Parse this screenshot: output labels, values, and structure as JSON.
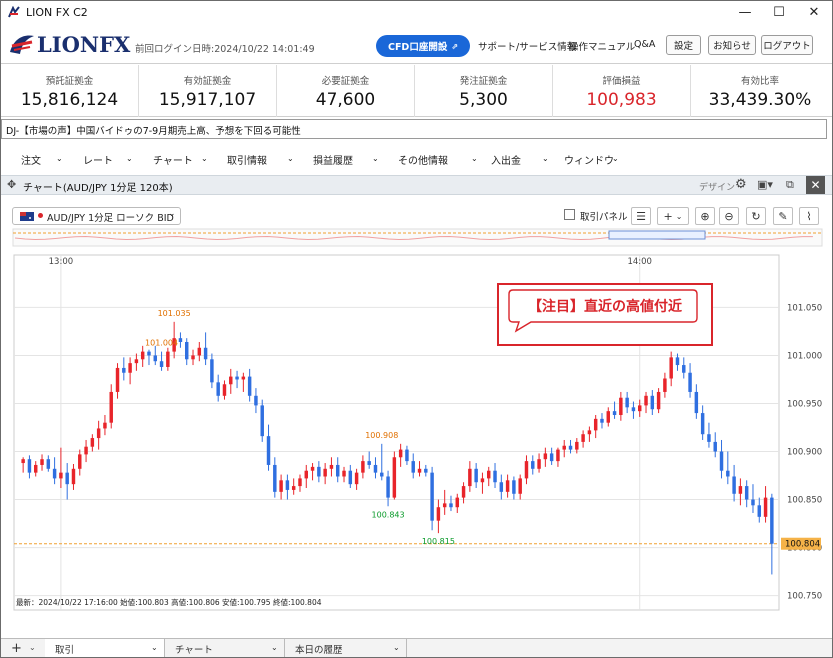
{
  "window": {
    "title": "LION FX C2",
    "controls": {
      "minimize": "—",
      "maximize": "☐",
      "close": "✕"
    }
  },
  "header": {
    "logo": "LIONFX",
    "last_login": "前回ログイン日時:2024/10/22 14:01:49",
    "cfd_button": "CFD口座開設",
    "links": [
      "サポート/サービス情報",
      "操作マニュアル",
      "Q&A"
    ],
    "buttons": [
      "設定",
      "お知らせ",
      "ログアウト"
    ]
  },
  "account": [
    {
      "label": "預託証拠金",
      "value": "15,816,124"
    },
    {
      "label": "有効証拠金",
      "value": "15,917,107"
    },
    {
      "label": "必要証拠金",
      "value": "47,600"
    },
    {
      "label": "発注証拠金",
      "value": "5,300"
    },
    {
      "label": "評価損益",
      "value": "100,983",
      "color": "#d9252b"
    },
    {
      "label": "有効比率",
      "value": "33,439.30%"
    }
  ],
  "news": "DJ-【市場の声】中国バイドゥの7-9月期売上高、予想を下回る可能性",
  "menu": [
    "注文",
    "レート",
    "チャート",
    "取引情報",
    "損益履歴",
    "その他情報",
    "入出金",
    "ウィンドウ"
  ],
  "panel": {
    "title": "チャート(AUD/JPY 1分足 120本)",
    "design_label": "デザイン"
  },
  "toolbar": {
    "symbol": "AUD/JPY 1分足 ローソク BID",
    "trade_panel": "取引パネル",
    "plus": "+",
    "caret": "⌄"
  },
  "chart_data": {
    "type": "candlestick",
    "symbol": "AUD/JPY",
    "x_labels": [
      "13:00",
      "14:00"
    ],
    "y_ticks": [
      101.05,
      101.0,
      100.95,
      100.9,
      100.85,
      100.8,
      100.75
    ],
    "y_tick_labels": [
      "101.050",
      "101.000",
      "100.950",
      "100.900",
      "100.850",
      "100.800",
      "100.750"
    ],
    "ylim": [
      100.735,
      101.09
    ],
    "current_price": "100.804",
    "current_price_value": 100.804,
    "annotations": [
      {
        "text": "101.035",
        "price": 101.035,
        "kind": "high",
        "color": "#e07000"
      },
      {
        "text": "100.908",
        "price": 100.908,
        "kind": "high",
        "color": "#e07000"
      },
      {
        "text": "100.843",
        "price": 100.843,
        "kind": "low",
        "color": "#0a9a2a"
      },
      {
        "text": "100.815",
        "price": 100.815,
        "kind": "low",
        "color": "#0a9a2a"
      },
      {
        "text": "101.004",
        "price": 101.004,
        "kind": "high",
        "color": "#e07000"
      }
    ],
    "callout": "【注目】直近の高値付近",
    "status": "最新：2024/10/22 17:16:00 始値:100.803 高値:100.806 安値:100.795 終値:100.804",
    "up_color": "#e8242a",
    "down_color": "#2f6fe0",
    "candles": [
      [
        100.888,
        100.894,
        100.878,
        100.892
      ],
      [
        100.892,
        100.896,
        100.872,
        100.878
      ],
      [
        100.878,
        100.89,
        100.874,
        100.886
      ],
      [
        100.886,
        100.897,
        100.88,
        100.892
      ],
      [
        100.892,
        100.896,
        100.879,
        100.882
      ],
      [
        100.882,
        100.894,
        100.866,
        100.872
      ],
      [
        100.872,
        100.904,
        100.862,
        100.878
      ],
      [
        100.878,
        100.888,
        100.85,
        100.866
      ],
      [
        100.866,
        100.887,
        100.86,
        100.882
      ],
      [
        100.882,
        100.902,
        100.875,
        100.897
      ],
      [
        100.897,
        100.912,
        100.889,
        100.905
      ],
      [
        100.905,
        100.918,
        100.9,
        100.914
      ],
      [
        100.914,
        100.932,
        100.902,
        100.924
      ],
      [
        100.924,
        100.938,
        100.917,
        100.93
      ],
      [
        100.93,
        100.97,
        100.924,
        100.962
      ],
      [
        100.962,
        100.992,
        100.955,
        100.987
      ],
      [
        100.987,
        100.998,
        100.974,
        100.982
      ],
      [
        100.982,
        100.998,
        100.97,
        100.992
      ],
      [
        100.992,
        101.002,
        100.984,
        100.996
      ],
      [
        100.996,
        101.01,
        100.988,
        101.004
      ],
      [
        101.004,
        101.006,
        100.99,
        101.0
      ],
      [
        101.0,
        101.01,
        100.99,
        100.994
      ],
      [
        100.994,
        101.004,
        100.984,
        100.988
      ],
      [
        100.988,
        101.008,
        100.984,
        101.004
      ],
      [
        101.004,
        101.035,
        100.997,
        101.018
      ],
      [
        101.018,
        101.024,
        101.008,
        101.014
      ],
      [
        101.014,
        101.018,
        100.99,
        100.996
      ],
      [
        100.996,
        101.006,
        100.99,
        101.0
      ],
      [
        101.0,
        101.014,
        100.994,
        101.008
      ],
      [
        101.008,
        101.024,
        100.99,
        100.996
      ],
      [
        100.996,
        101.002,
        100.966,
        100.972
      ],
      [
        100.972,
        100.98,
        100.952,
        100.958
      ],
      [
        100.958,
        100.974,
        100.954,
        100.97
      ],
      [
        100.97,
        100.986,
        100.96,
        100.978
      ],
      [
        100.978,
        100.984,
        100.966,
        100.975
      ],
      [
        100.975,
        100.982,
        100.962,
        100.978
      ],
      [
        100.978,
        100.986,
        100.952,
        100.958
      ],
      [
        100.958,
        100.966,
        100.94,
        100.948
      ],
      [
        100.948,
        100.954,
        100.91,
        100.916
      ],
      [
        100.916,
        100.928,
        100.88,
        100.886
      ],
      [
        100.886,
        100.894,
        100.852,
        100.858
      ],
      [
        100.858,
        100.876,
        100.85,
        100.87
      ],
      [
        100.87,
        100.876,
        100.85,
        100.86
      ],
      [
        100.86,
        100.872,
        100.855,
        100.864
      ],
      [
        100.864,
        100.876,
        100.858,
        100.872
      ],
      [
        100.872,
        100.886,
        100.862,
        100.88
      ],
      [
        100.88,
        100.888,
        100.87,
        100.884
      ],
      [
        100.884,
        100.89,
        100.868,
        100.874
      ],
      [
        100.874,
        100.888,
        100.866,
        100.882
      ],
      [
        100.882,
        100.894,
        100.874,
        100.886
      ],
      [
        100.886,
        100.894,
        100.868,
        100.874
      ],
      [
        100.874,
        100.884,
        100.868,
        100.88
      ],
      [
        100.88,
        100.886,
        100.862,
        100.866
      ],
      [
        100.866,
        100.882,
        100.86,
        100.878
      ],
      [
        100.878,
        100.896,
        100.872,
        100.89
      ],
      [
        100.89,
        100.9,
        100.882,
        100.886
      ],
      [
        100.886,
        100.894,
        100.872,
        100.878
      ],
      [
        100.878,
        100.908,
        100.87,
        100.874
      ],
      [
        100.874,
        100.88,
        100.843,
        100.852
      ],
      [
        100.852,
        100.9,
        100.85,
        100.894
      ],
      [
        100.894,
        100.908,
        100.884,
        100.902
      ],
      [
        100.902,
        100.906,
        100.886,
        100.89
      ],
      [
        100.89,
        100.898,
        100.872,
        100.878
      ],
      [
        100.878,
        100.89,
        100.874,
        100.882
      ],
      [
        100.882,
        100.886,
        100.874,
        100.878
      ],
      [
        100.878,
        100.884,
        100.818,
        100.828
      ],
      [
        100.828,
        100.85,
        100.815,
        100.842
      ],
      [
        100.842,
        100.86,
        100.834,
        100.846
      ],
      [
        100.846,
        100.854,
        100.838,
        100.842
      ],
      [
        100.842,
        100.856,
        100.836,
        100.852
      ],
      [
        100.852,
        100.868,
        100.846,
        100.864
      ],
      [
        100.864,
        100.89,
        100.858,
        100.882
      ],
      [
        100.882,
        100.888,
        100.862,
        100.868
      ],
      [
        100.868,
        100.878,
        100.856,
        100.872
      ],
      [
        100.872,
        100.884,
        100.864,
        100.88
      ],
      [
        100.88,
        100.888,
        100.862,
        100.868
      ],
      [
        100.868,
        100.876,
        100.85,
        100.858
      ],
      [
        100.858,
        100.876,
        100.852,
        100.87
      ],
      [
        100.87,
        100.874,
        100.85,
        100.856
      ],
      [
        100.856,
        100.876,
        100.85,
        100.872
      ],
      [
        100.872,
        100.896,
        100.866,
        100.89
      ],
      [
        100.89,
        100.896,
        100.876,
        100.882
      ],
      [
        100.882,
        100.898,
        100.878,
        100.892
      ],
      [
        100.892,
        100.904,
        100.884,
        100.898
      ],
      [
        100.898,
        100.904,
        100.886,
        100.89
      ],
      [
        100.89,
        100.904,
        100.884,
        100.902
      ],
      [
        100.902,
        100.912,
        100.894,
        100.906
      ],
      [
        100.906,
        100.912,
        100.898,
        100.902
      ],
      [
        100.902,
        100.914,
        100.898,
        100.91
      ],
      [
        100.91,
        100.922,
        100.904,
        100.918
      ],
      [
        100.918,
        100.926,
        100.91,
        100.922
      ],
      [
        100.922,
        100.938,
        100.914,
        100.934
      ],
      [
        100.934,
        100.94,
        100.924,
        100.93
      ],
      [
        100.93,
        100.946,
        100.926,
        100.942
      ],
      [
        100.942,
        100.952,
        100.934,
        100.938
      ],
      [
        100.938,
        100.962,
        100.932,
        100.956
      ],
      [
        100.956,
        100.962,
        100.94,
        100.946
      ],
      [
        100.946,
        100.952,
        100.934,
        100.942
      ],
      [
        100.942,
        100.954,
        100.936,
        100.948
      ],
      [
        100.948,
        100.962,
        100.94,
        100.958
      ],
      [
        100.958,
        100.964,
        100.938,
        100.944
      ],
      [
        100.944,
        100.966,
        100.94,
        100.962
      ],
      [
        100.962,
        100.982,
        100.956,
        100.976
      ],
      [
        100.976,
        101.004,
        100.968,
        100.998
      ],
      [
        100.998,
        101.002,
        100.984,
        100.99
      ],
      [
        100.99,
        100.998,
        100.976,
        100.982
      ],
      [
        100.982,
        100.992,
        100.956,
        100.962
      ],
      [
        100.962,
        100.97,
        100.934,
        100.94
      ],
      [
        100.94,
        100.948,
        100.912,
        100.918
      ],
      [
        100.918,
        100.93,
        100.904,
        100.91
      ],
      [
        100.91,
        100.92,
        100.894,
        100.9
      ],
      [
        100.9,
        100.912,
        100.872,
        100.88
      ],
      [
        100.88,
        100.9,
        100.866,
        100.874
      ],
      [
        100.874,
        100.886,
        100.848,
        100.856
      ],
      [
        100.856,
        100.872,
        100.844,
        100.864
      ],
      [
        100.864,
        100.87,
        100.842,
        100.85
      ],
      [
        100.85,
        100.866,
        100.836,
        100.844
      ],
      [
        100.844,
        100.852,
        100.826,
        100.832
      ],
      [
        100.832,
        100.864,
        100.826,
        100.852
      ],
      [
        100.852,
        100.856,
        100.772,
        100.804
      ]
    ]
  },
  "bottom_tabs": [
    "取引",
    "チャート",
    "本日の履歴"
  ],
  "bottom_add": "+"
}
